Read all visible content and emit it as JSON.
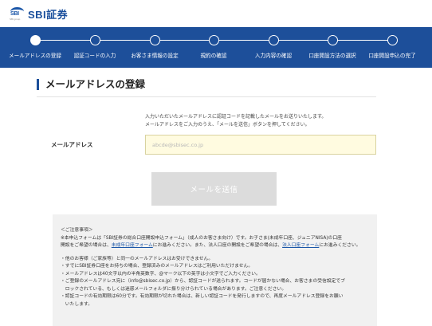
{
  "header": {
    "logo_mark_text": "SBI",
    "logo_mark_small": "SBI group",
    "logo_text": "SBI証券"
  },
  "steps": [
    {
      "label": "メールアドレスの登録",
      "active": true
    },
    {
      "label": "認証コードの入力",
      "active": false
    },
    {
      "label": "お客さま情報の設定",
      "active": false
    },
    {
      "label": "規約の確認",
      "active": false
    },
    {
      "label": "入力内容の確認",
      "active": false
    },
    {
      "label": "口座開設方法の選択",
      "active": false
    },
    {
      "label": "口座開設申込の完了",
      "active": false
    }
  ],
  "page": {
    "title": "メールアドレスの登録",
    "notice_line1": "入力いただいたメールアドレスに認証コードを記載したメールをお送りいたします。",
    "notice_line2": "メールアドレスをご入力のうえ、「メールを送信」ボタンを押してください。"
  },
  "form": {
    "email_label": "メールアドレス",
    "email_placeholder": "abcde@sbisec.co.jp",
    "email_value": ""
  },
  "submit": {
    "label": "メールを送信",
    "enabled": false
  },
  "notes": {
    "heading": "＜ご注意事項＞",
    "line1": "※本申込フォームは「SBI証券の総合口座開設申込フォーム」（成人のお客さま向け）です。お子さま(未成年口座、ジュニアNISA)の口座",
    "line2_prefix": "開設をご希望の場合は、",
    "link_minor": "未成年口座フォーム",
    "line2_middle": "にお進みください。また、法人口座の開設をご希望の場合は、",
    "link_corporate": "法人口座フォーム",
    "line2_suffix": "にお進みください。",
    "bullets": [
      "・他のお客様（ご家族等）と同一のメールアドレスはお受けできません。",
      "・すでにSBI証券口座をお持ちの場合、登録済みのメールアドレスはご利用いただけません。",
      "・メールアドレスは40文字以内の半角英数字、@マーク以下の英字は小文字でご入力ください。",
      "・ご登録のメールアドレス宛に（info@sbisec.co.jp）から、認証コードが送られます。コードが届かない場合、お客さまの受信設定でブ",
      "　ロックされている、もしくは迷惑メールフォルダに振り分けられている場合があります。ご注意ください。",
      "・認証コードの有効期限は60分です。有効期限が切れた場合は、新しい認証コードを発行しますので、再度メールアドレス登録をお願い",
      "　いたします。"
    ]
  },
  "colors": {
    "brand_blue": "#1d4f9a",
    "input_bg": "#fffbe0",
    "button_disabled": "#dcdcdc",
    "notes_bg": "#f1f1f1",
    "link": "#1a56a8"
  }
}
